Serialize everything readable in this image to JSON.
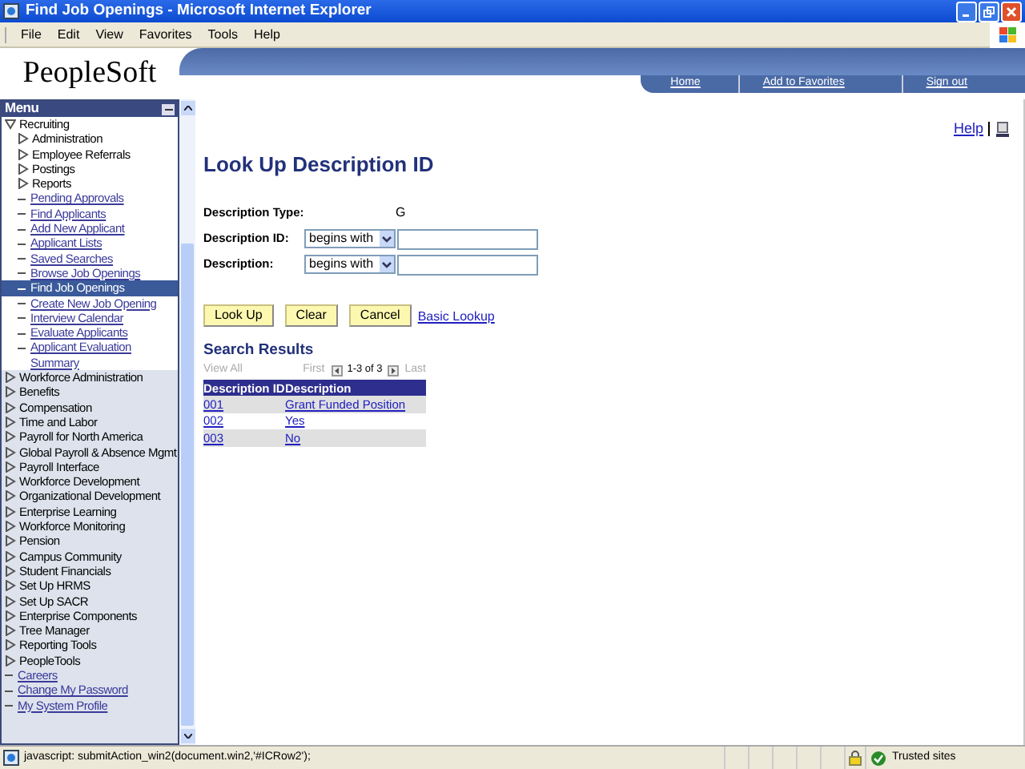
{
  "window": {
    "title": "Find Job Openings - Microsoft Internet Explorer"
  },
  "menu_bar": [
    "File",
    "Edit",
    "View",
    "Favorites",
    "Tools",
    "Help"
  ],
  "header": {
    "logo": "PeopleSoft",
    "links": [
      "Home",
      "Add to Favorites",
      "Sign out"
    ]
  },
  "menu": {
    "title": "Menu",
    "items": [
      {
        "label": "Recruiting",
        "kind": "folder",
        "expanded": true,
        "children": [
          {
            "label": "Administration",
            "kind": "folder",
            "expanded": false,
            "selected": false
          },
          {
            "label": "Employee Referrals",
            "kind": "folder",
            "expanded": false,
            "selected": false
          },
          {
            "label": "Postings",
            "kind": "folder",
            "expanded": false,
            "selected": false
          },
          {
            "label": "Reports",
            "kind": "folder",
            "expanded": false,
            "selected": false
          },
          {
            "label": "Pending Approvals",
            "kind": "link",
            "selected": false
          },
          {
            "label": "Find Applicants",
            "kind": "link",
            "selected": false
          },
          {
            "label": "Add New Applicant",
            "kind": "link",
            "selected": false
          },
          {
            "label": "Applicant Lists",
            "kind": "link",
            "selected": false
          },
          {
            "label": "Saved Searches",
            "kind": "link",
            "selected": false
          },
          {
            "label": "Browse Job Openings",
            "kind": "link",
            "selected": false
          },
          {
            "label": "Find Job Openings",
            "kind": "link",
            "selected": true
          },
          {
            "label": "Create New Job Opening",
            "kind": "link",
            "selected": false
          },
          {
            "label": "Interview Calendar",
            "kind": "link",
            "selected": false
          },
          {
            "label": "Evaluate Applicants",
            "kind": "link",
            "selected": false
          },
          {
            "label": "Applicant Evaluation Summary",
            "kind": "link",
            "selected": false
          }
        ]
      },
      {
        "label": "Workforce Administration",
        "kind": "folder",
        "expanded": false
      },
      {
        "label": "Benefits",
        "kind": "folder",
        "expanded": false
      },
      {
        "label": "Compensation",
        "kind": "folder",
        "expanded": false
      },
      {
        "label": "Time and Labor",
        "kind": "folder",
        "expanded": false
      },
      {
        "label": "Payroll for North America",
        "kind": "folder",
        "expanded": false
      },
      {
        "label": "Global Payroll & Absence Mgmt",
        "kind": "folder",
        "expanded": false
      },
      {
        "label": "Payroll Interface",
        "kind": "folder",
        "expanded": false
      },
      {
        "label": "Workforce Development",
        "kind": "folder",
        "expanded": false
      },
      {
        "label": "Organizational Development",
        "kind": "folder",
        "expanded": false
      },
      {
        "label": "Enterprise Learning",
        "kind": "folder",
        "expanded": false
      },
      {
        "label": "Workforce Monitoring",
        "kind": "folder",
        "expanded": false
      },
      {
        "label": "Pension",
        "kind": "folder",
        "expanded": false
      },
      {
        "label": "Campus Community",
        "kind": "folder",
        "expanded": false
      },
      {
        "label": "Student Financials",
        "kind": "folder",
        "expanded": false
      },
      {
        "label": "Set Up HRMS",
        "kind": "folder",
        "expanded": false
      },
      {
        "label": "Set Up SACR",
        "kind": "folder",
        "expanded": false
      },
      {
        "label": "Enterprise Components",
        "kind": "folder",
        "expanded": false
      },
      {
        "label": "Tree Manager",
        "kind": "folder",
        "expanded": false
      },
      {
        "label": "Reporting Tools",
        "kind": "folder",
        "expanded": false
      },
      {
        "label": "PeopleTools",
        "kind": "folder",
        "expanded": false
      },
      {
        "label": "Careers",
        "kind": "link"
      },
      {
        "label": "Change My Password",
        "kind": "link"
      },
      {
        "label": "My System Profile",
        "kind": "link"
      }
    ]
  },
  "help_link": "Help",
  "page": {
    "title": "Look Up Description ID",
    "fields": [
      {
        "label": "Description Type:",
        "kind": "value",
        "value": "G"
      },
      {
        "label": "Description ID:",
        "kind": "search",
        "operator": "begins with"
      },
      {
        "label": "Description:",
        "kind": "search",
        "operator": "begins with"
      }
    ],
    "buttons": [
      "Look Up",
      "Clear",
      "Cancel"
    ],
    "basic_lookup": "Basic Lookup"
  },
  "results": {
    "title": "Search Results",
    "view_all": "View All",
    "first": "First",
    "range": "1-3 of 3",
    "last": "Last",
    "columns": [
      "Description ID",
      "Description"
    ],
    "rows": [
      [
        "001",
        "Grant Funded Position"
      ],
      [
        "002",
        "Yes"
      ],
      [
        "003",
        "No"
      ]
    ]
  },
  "status_bar": {
    "text": "javascript: submitAction_win2(document.win2,'#ICRow2');",
    "zone": "Trusted sites"
  }
}
